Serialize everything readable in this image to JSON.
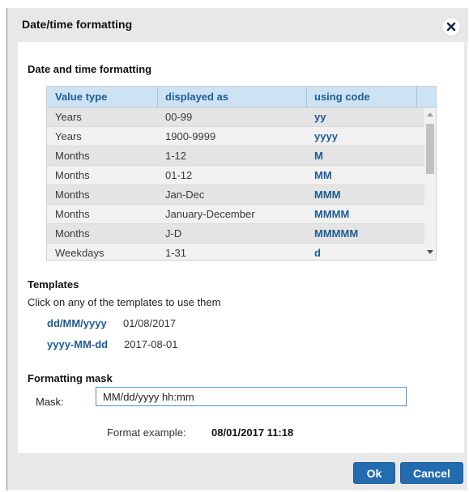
{
  "dialog": {
    "title": "Date/time formatting",
    "close_icon": "close-icon"
  },
  "formatting": {
    "section_title": "Date and time formatting",
    "columns": [
      "Value type",
      "displayed as",
      "using code"
    ],
    "rows": [
      {
        "value_type": "Years",
        "displayed_as": "00-99",
        "code": "yy"
      },
      {
        "value_type": "Years",
        "displayed_as": "1900-9999",
        "code": "yyyy"
      },
      {
        "value_type": "Months",
        "displayed_as": "1-12",
        "code": "M"
      },
      {
        "value_type": "Months",
        "displayed_as": "01-12",
        "code": "MM"
      },
      {
        "value_type": "Months",
        "displayed_as": "Jan-Dec",
        "code": "MMM"
      },
      {
        "value_type": "Months",
        "displayed_as": "January-December",
        "code": "MMMM"
      },
      {
        "value_type": "Months",
        "displayed_as": "J-D",
        "code": "MMMMM"
      },
      {
        "value_type": "Weekdays",
        "displayed_as": "1-31",
        "code": "d"
      }
    ]
  },
  "templates": {
    "section_title": "Templates",
    "hint": "Click on any of the templates to use them",
    "items": [
      {
        "pattern": "dd/MM/yyyy",
        "sample": "01/08/2017"
      },
      {
        "pattern": "yyyy-MM-dd",
        "sample": "2017-08-01"
      }
    ]
  },
  "mask": {
    "section_title": "Formatting mask",
    "label": "Mask:",
    "value": "MM/dd/yyyy hh:mm",
    "example_label": "Format example:",
    "example_value": "08/01/2017 11:18"
  },
  "buttons": {
    "ok": "Ok",
    "cancel": "Cancel"
  },
  "colors": {
    "accent": "#246cb0",
    "link": "#1f5b93",
    "header_bg": "#cde3f3"
  }
}
